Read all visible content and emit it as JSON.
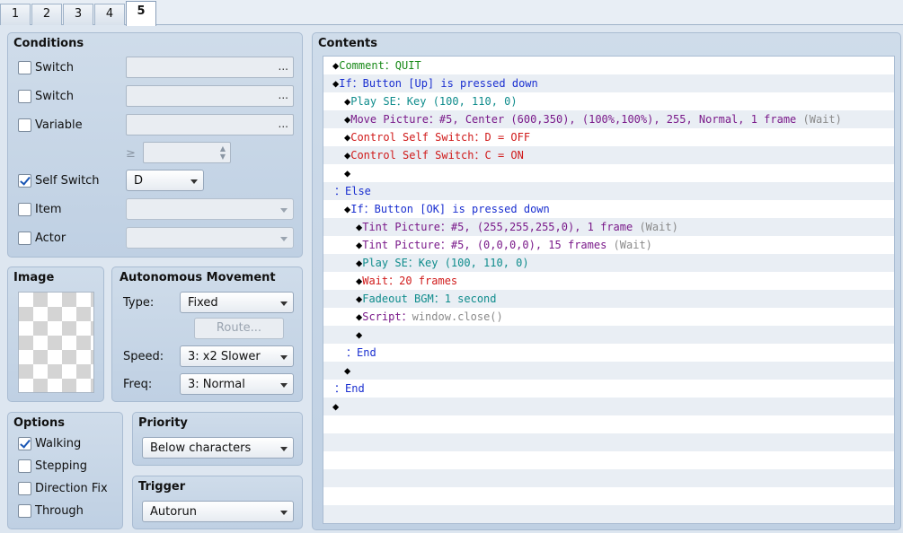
{
  "tabs": [
    "1",
    "2",
    "3",
    "4",
    "5"
  ],
  "active_tab": "5",
  "conditions": {
    "title": "Conditions",
    "switch1_label": "Switch",
    "switch2_label": "Switch",
    "variable_label": "Variable",
    "ge_symbol": "≥",
    "dots": "...",
    "self_switch_label": "Self Switch",
    "self_switch_value": "D",
    "item_label": "Item",
    "actor_label": "Actor"
  },
  "image": {
    "title": "Image"
  },
  "movement": {
    "title": "Autonomous Movement",
    "type_label": "Type:",
    "type_value": "Fixed",
    "route_label": "Route...",
    "speed_label": "Speed:",
    "speed_value": "3: x2 Slower",
    "freq_label": "Freq:",
    "freq_value": "3: Normal"
  },
  "options": {
    "title": "Options",
    "walking": "Walking",
    "stepping": "Stepping",
    "direction_fix": "Direction Fix",
    "through": "Through"
  },
  "priority": {
    "title": "Priority",
    "value": "Below characters"
  },
  "trigger": {
    "title": "Trigger",
    "value": "Autorun"
  },
  "contents": {
    "title": "Contents",
    "lines": [
      {
        "indent": 0,
        "diamond": true,
        "parts": [
          {
            "t": "Comment：QUIT",
            "c": "green"
          }
        ]
      },
      {
        "indent": 0,
        "diamond": true,
        "parts": [
          {
            "t": "If：Button [Up] is pressed down",
            "c": "blue"
          }
        ]
      },
      {
        "indent": 1,
        "diamond": true,
        "parts": [
          {
            "t": "Play SE：Key (100, 110, 0)",
            "c": "teal"
          }
        ]
      },
      {
        "indent": 1,
        "diamond": true,
        "parts": [
          {
            "t": "Move Picture：#5, Center (600,350), (100%,100%), 255, Normal, 1 frame ",
            "c": "purple"
          },
          {
            "t": "(Wait)",
            "c": "gray"
          }
        ]
      },
      {
        "indent": 1,
        "diamond": true,
        "parts": [
          {
            "t": "Control Self Switch：D = OFF",
            "c": "red"
          }
        ]
      },
      {
        "indent": 1,
        "diamond": true,
        "parts": [
          {
            "t": "Control Self Switch：C = ON",
            "c": "red"
          }
        ]
      },
      {
        "indent": 1,
        "diamond": true,
        "parts": []
      },
      {
        "indent": 0,
        "diamond": false,
        "parts": [
          {
            "t": "：Else",
            "c": "blue"
          }
        ]
      },
      {
        "indent": 1,
        "diamond": true,
        "parts": [
          {
            "t": "If：Button [OK] is pressed down",
            "c": "blue"
          }
        ]
      },
      {
        "indent": 2,
        "diamond": true,
        "parts": [
          {
            "t": "Tint Picture：#5, (255,255,255,0), 1 frame ",
            "c": "purple"
          },
          {
            "t": "(Wait)",
            "c": "gray"
          }
        ]
      },
      {
        "indent": 2,
        "diamond": true,
        "parts": [
          {
            "t": "Tint Picture：#5, (0,0,0,0), 15 frames ",
            "c": "purple"
          },
          {
            "t": "(Wait)",
            "c": "gray"
          }
        ]
      },
      {
        "indent": 2,
        "diamond": true,
        "parts": [
          {
            "t": "Play SE：Key (100, 110, 0)",
            "c": "teal"
          }
        ]
      },
      {
        "indent": 2,
        "diamond": true,
        "parts": [
          {
            "t": "Wait：20 frames",
            "c": "red"
          }
        ]
      },
      {
        "indent": 2,
        "diamond": true,
        "parts": [
          {
            "t": "Fadeout BGM：1 second",
            "c": "teal"
          }
        ]
      },
      {
        "indent": 2,
        "diamond": true,
        "parts": [
          {
            "t": "Script：",
            "c": "purple"
          },
          {
            "t": "window.close()",
            "c": "gray"
          }
        ]
      },
      {
        "indent": 2,
        "diamond": true,
        "parts": []
      },
      {
        "indent": 1,
        "diamond": false,
        "parts": [
          {
            "t": "：End",
            "c": "blue"
          }
        ]
      },
      {
        "indent": 1,
        "diamond": true,
        "parts": []
      },
      {
        "indent": 0,
        "diamond": false,
        "parts": [
          {
            "t": "：End",
            "c": "blue"
          }
        ]
      },
      {
        "indent": 0,
        "diamond": true,
        "parts": []
      }
    ]
  }
}
